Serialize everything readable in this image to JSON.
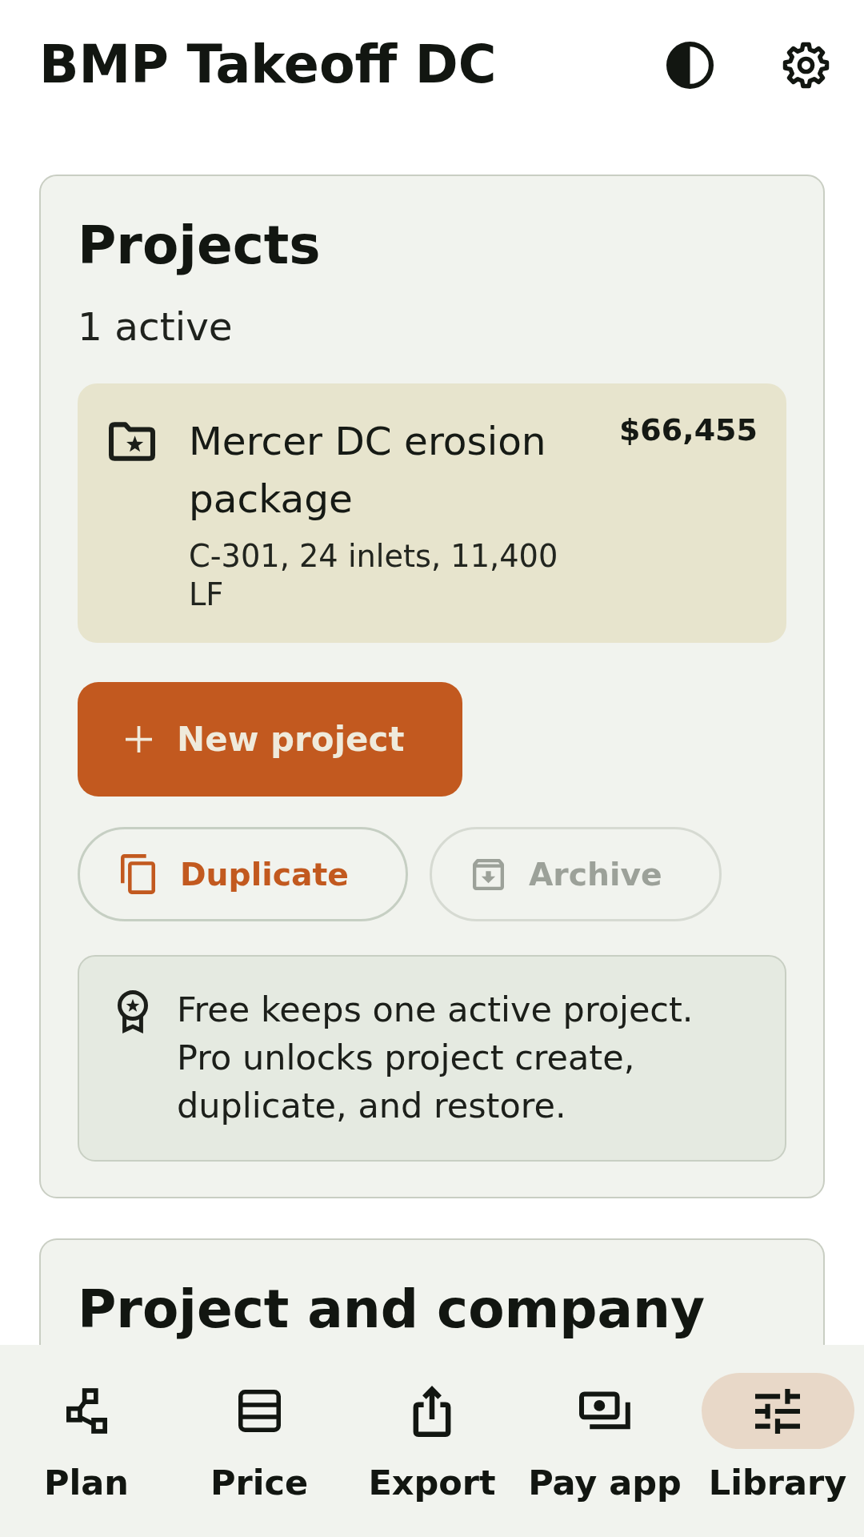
{
  "app_bar": {
    "title": "BMP Takeoff DC"
  },
  "projects_card": {
    "heading": "Projects",
    "count": "1 active",
    "projects": [
      {
        "name": "Mercer DC erosion package",
        "details": "C-301, 24 inlets, 11,400 LF",
        "total": "$66,455",
        "selected": true
      }
    ],
    "new_project_button": {
      "label": "New project"
    },
    "secondary_actions": [
      {
        "label": "Duplicate",
        "disabled": false
      },
      {
        "label": "Archive",
        "disabled": true
      }
    ],
    "notice": {
      "text": "Free keeps one active project. Pro unlocks project create, duplicate, and restore."
    }
  },
  "company_card": {
    "heading": "Project and company"
  },
  "bottom_nav": {
    "items": [
      {
        "label": "Plan",
        "selected": false
      },
      {
        "label": "Price",
        "selected": false
      },
      {
        "label": "Export",
        "selected": false
      },
      {
        "label": "Pay app",
        "selected": false
      },
      {
        "label": "Library",
        "selected": true
      }
    ]
  }
}
